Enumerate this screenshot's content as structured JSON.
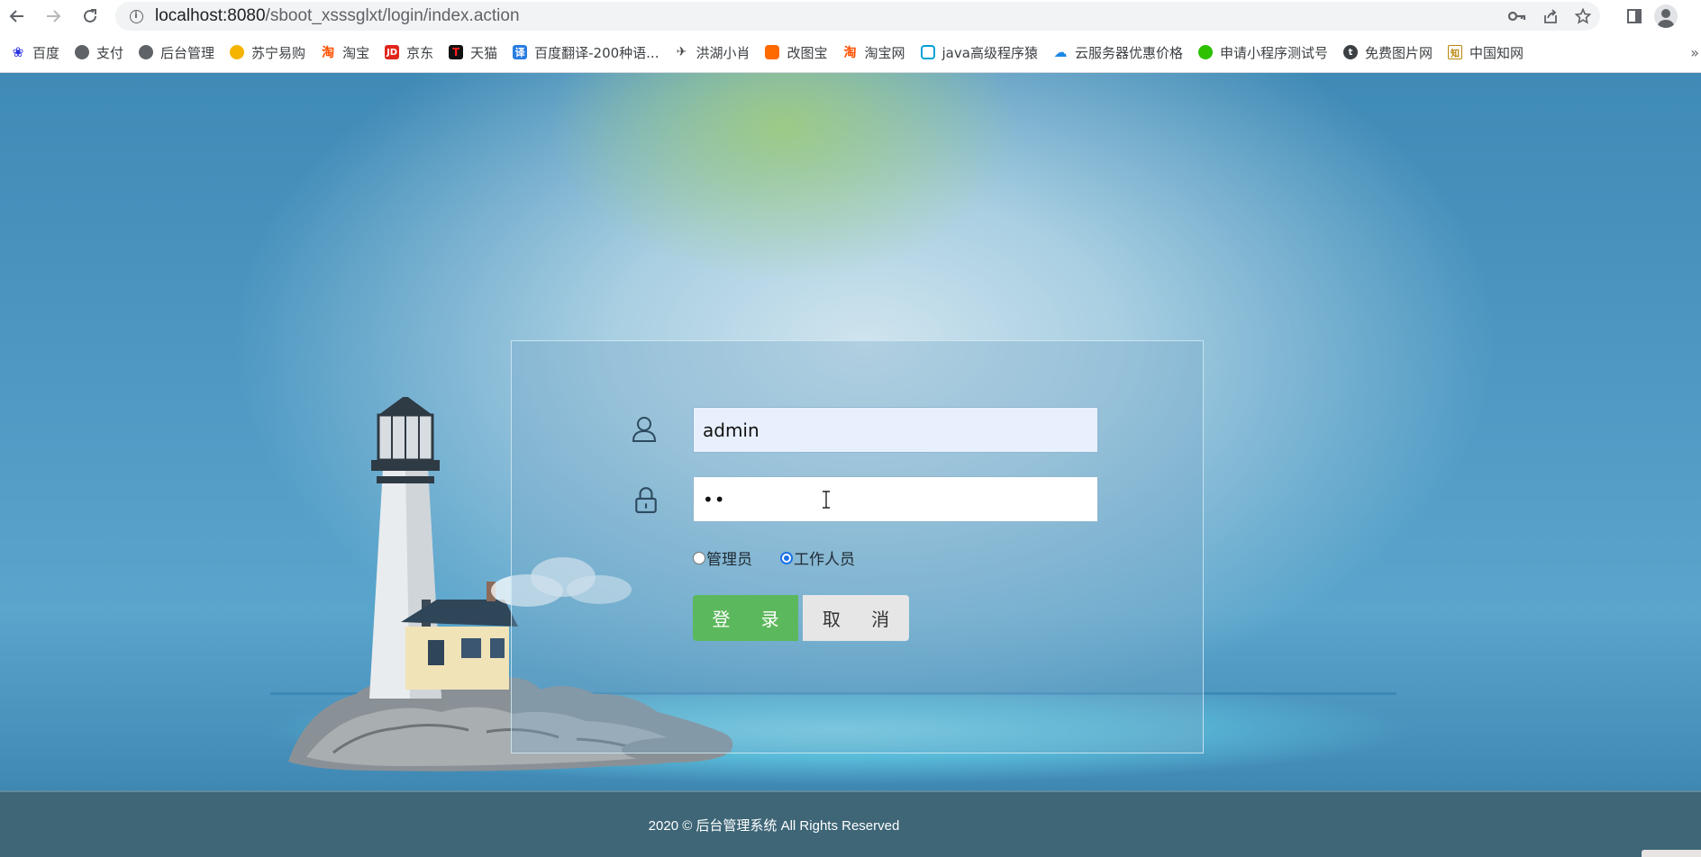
{
  "browser": {
    "url_host": "localhost:8080",
    "url_path": "/sboot_xsssglxt/login/index.action",
    "back_icon": "arrow-left-icon",
    "forward_icon": "arrow-right-icon",
    "reload_icon": "reload-icon",
    "bookmarks": [
      {
        "label": "百度",
        "icon": "paw-icon",
        "color": "#2932e1"
      },
      {
        "label": "支付",
        "icon": "globe-icon",
        "color": "#5f6368"
      },
      {
        "label": "后台管理",
        "icon": "globe-icon",
        "color": "#5f6368"
      },
      {
        "label": "苏宁易购",
        "icon": "lion-icon",
        "color": "#f5b400"
      },
      {
        "label": "淘宝",
        "icon": "taobao-icon",
        "color": "#ff5000"
      },
      {
        "label": "京东",
        "icon": "jd-icon",
        "color": "#e1251b"
      },
      {
        "label": "天猫",
        "icon": "tmall-icon",
        "color": "#d8000f"
      },
      {
        "label": "百度翻译-200种语...",
        "icon": "translate-icon",
        "color": "#2a7de1"
      },
      {
        "label": "洪湖小肖",
        "icon": "bird-icon",
        "color": "#444444"
      },
      {
        "label": "改图宝",
        "icon": "photo-icon",
        "color": "#ff6a00"
      },
      {
        "label": "淘宝网",
        "icon": "taobao-icon",
        "color": "#ff5000"
      },
      {
        "label": "java高级程序猿",
        "icon": "bilibili-icon",
        "color": "#00a1d6"
      },
      {
        "label": "云服务器优惠价格",
        "icon": "cloud-icon",
        "color": "#1e88e5"
      },
      {
        "label": "申请小程序测试号",
        "icon": "wechat-icon",
        "color": "#2dc100"
      },
      {
        "label": "免费图片网",
        "icon": "t-icon",
        "color": "#3c4043"
      },
      {
        "label": "中国知网",
        "icon": "cnki-icon",
        "color": "#b8860b"
      }
    ],
    "bookmarks_overflow": "»"
  },
  "login": {
    "username_value": "admin",
    "password_value": "••",
    "roles": [
      {
        "label": "管理员",
        "checked": false
      },
      {
        "label": "工作人员",
        "checked": true
      }
    ],
    "login_label": "登 录",
    "cancel_label": "取 消"
  },
  "footer": {
    "text": "2020 © 后台管理系统 All Rights Reserved"
  },
  "colors": {
    "login_button": "#5cb85c",
    "cancel_button": "#e6e6e6",
    "footer_bg": "#3e6677",
    "radio_checked": "#1a73e8"
  }
}
